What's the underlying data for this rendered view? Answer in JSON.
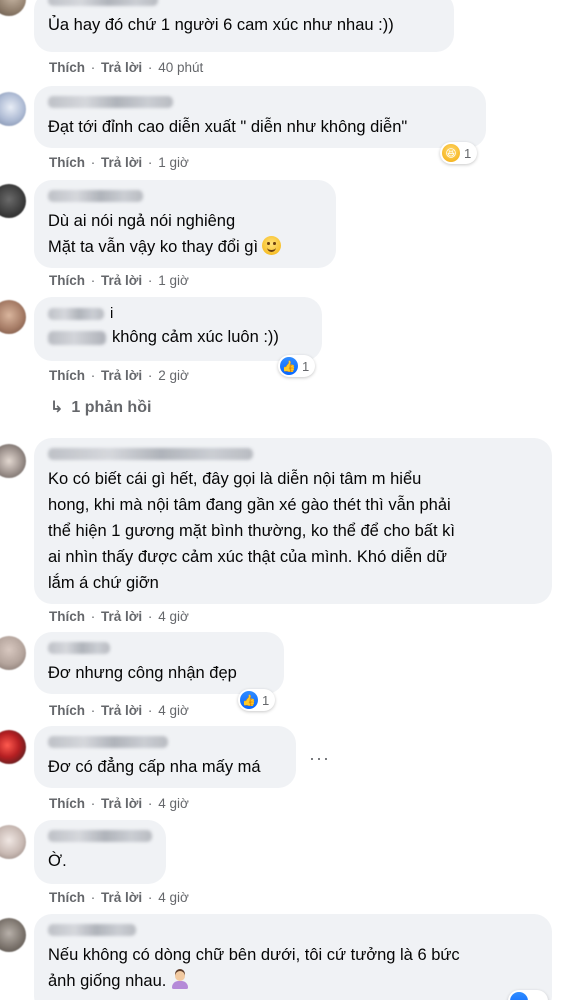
{
  "actions": {
    "like": "Thích",
    "reply": "Trả lời",
    "sep": "·"
  },
  "comments": [
    {
      "text": "Ủa hay đó chứ 1 người 6 cam xúc như nhau :))",
      "time": "40 phút"
    },
    {
      "text": "Đạt tới đỉnh cao diễn xuất \" diễn như không diễn\"",
      "time": "1 giờ",
      "reaction": {
        "icon": "haha-icon",
        "count": "1"
      }
    },
    {
      "text": "Dù ai nói ngả nói nghiêng\nMặt ta vẫn vậy ko thay đổi gì",
      "time": "1 giờ",
      "emoji": "smile-emoji"
    },
    {
      "text_prefix": "i",
      "text": "không cảm xúc luôn :))",
      "time": "2 giờ",
      "reaction": {
        "icon": "like-icon",
        "count": "1"
      }
    },
    {
      "text": "Ko có biết cái gì hết, đây gọi là diễn nội tâm m hiểu\nhong, khi mà nội tâm đang gần xé gào thét thì vẫn phải\nthể hiện 1 gương mặt bình thường, ko thể để cho bất kì\nai nhìn thấy được cảm xúc thật của mình. Khó diễn dữ\nlắm á chứ giỡn",
      "time": "4 giờ"
    },
    {
      "text": "Đơ nhưng công nhận đẹp",
      "time": "4 giờ",
      "reaction": {
        "icon": "like-icon",
        "count": "1"
      }
    },
    {
      "text": "Đơ có đẳng cấp nha mấy má",
      "time": "4 giờ",
      "more": "···"
    },
    {
      "text": "Ờ.",
      "time": "4 giờ"
    },
    {
      "text": "Nếu không có dòng chữ bên dưới, tôi cứ tưởng là 6 bức\nảnh giống nhau.",
      "emoji": "person-emoji"
    }
  ],
  "replies_link": {
    "arrow": "↳",
    "label": "1 phản hồi"
  }
}
